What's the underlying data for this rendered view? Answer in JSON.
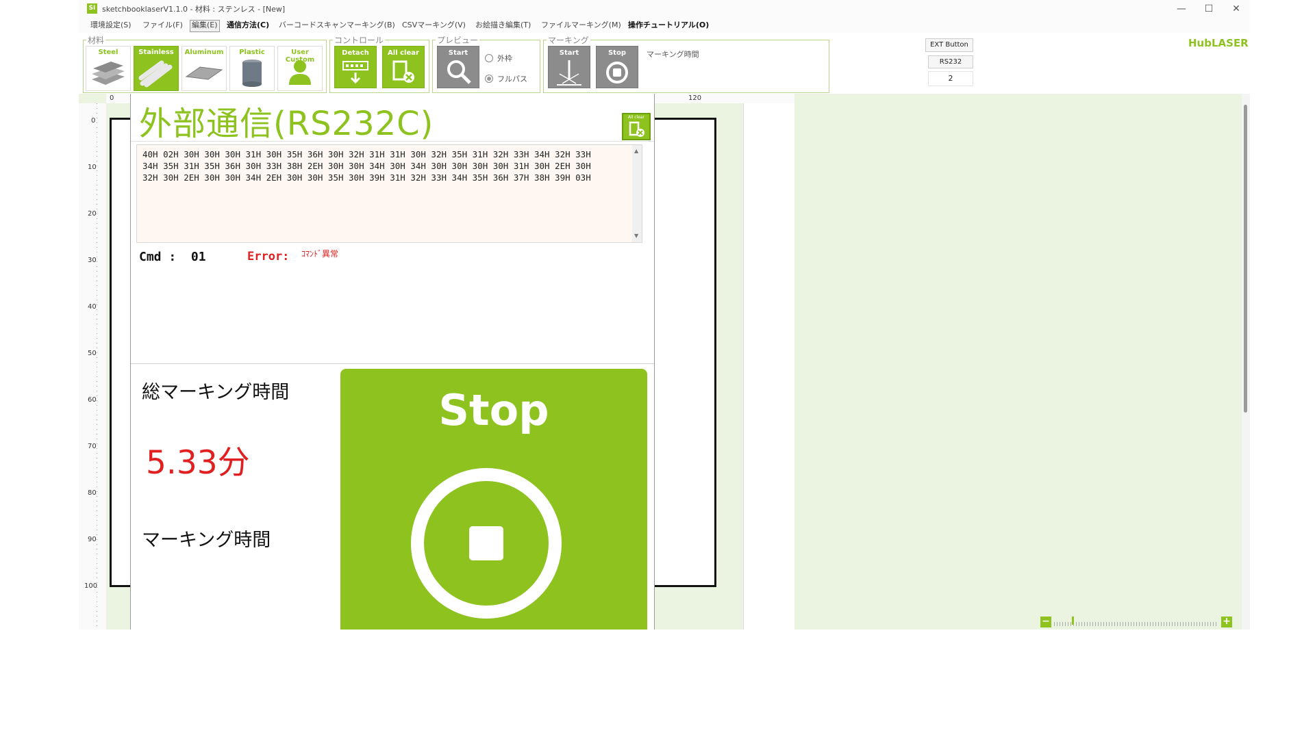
{
  "titlebar": {
    "app_icon": "SI",
    "title": "sketchbooklaserV1.1.0 - 材料 : ステンレス - [New]",
    "minimize": "—",
    "maximize": "☐",
    "close": "✕"
  },
  "menu": {
    "items": [
      "環境設定(S)",
      "ファイル(F)",
      "編集(E)",
      "通信方法(C)",
      "バーコードスキャンマーキング(B)",
      "CSVマーキング(V)",
      "お絵描き編集(T)",
      "ファイルマーキング(M)",
      "操作チュートリアル(O)"
    ],
    "brand": "HubLASER"
  },
  "ribbon": {
    "material": {
      "label": "材料",
      "tiles": [
        "Steel",
        "Stainless",
        "Aluminum",
        "Plastic",
        "User Custom"
      ],
      "selected": "Stainless"
    },
    "control": {
      "label": "コントロール",
      "detach": "Detach",
      "all_clear": "All clear"
    },
    "preview": {
      "label": "プレビュー",
      "start": "Start",
      "option_outer": "外枠",
      "option_full": "フルパス",
      "selected": "フルパス"
    },
    "marking": {
      "label": "マーキング",
      "start": "Start",
      "stop": "Stop",
      "time_label": "マーキング時間"
    }
  },
  "ext_panel": {
    "ext_button": "EXT Button",
    "rs232": "RS232",
    "value": "2"
  },
  "ruler": {
    "h_labels": [
      "0",
      "120"
    ],
    "v_labels": [
      "0",
      "10",
      "20",
      "30",
      "40",
      "50",
      "60",
      "70",
      "80",
      "90",
      "100"
    ]
  },
  "dialog": {
    "title": "外部通信(RS232C)",
    "all_clear_small": "All clear",
    "hex_lines": [
      "40H 02H 30H 30H 30H 31H 30H 35H 36H 30H 32H 31H 31H 30H 32H 35H 31H 32H 33H 34H 32H 33H",
      "34H 35H 31H 35H 36H 30H 33H 38H 2EH 30H 30H 34H 30H 34H 30H 30H 30H 30H 31H 30H 2EH 30H",
      "32H 30H 2EH 30H 30H 34H 2EH 30H 30H 35H 30H 39H 31H 32H 33H 34H 35H 36H 37H 38H 39H 03H"
    ],
    "cmd_label": "Cmd :  01",
    "error_label": "Error:",
    "error_value": "ｺﾏﾝﾄﾞ異常",
    "total_time_label": "総マーキング時間",
    "total_time_value": "5.33分",
    "marking_time_label": "マーキング時間",
    "stop_button": "Stop"
  },
  "zoom": {
    "minus": "−",
    "plus": "+"
  },
  "colors": {
    "accent": "#8dc21f",
    "error": "#e02020",
    "canvas": "#eaf4e1"
  }
}
